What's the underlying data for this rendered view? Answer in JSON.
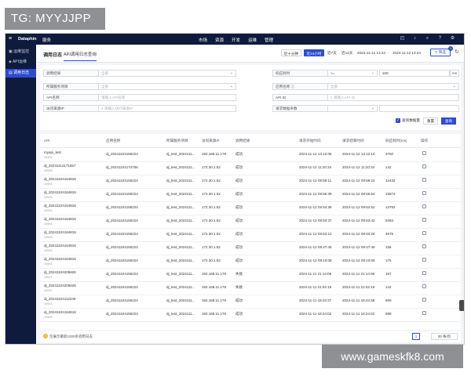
{
  "overlay_label": "TG: MYYJJPP",
  "watermark": "www.gameskfk8.com",
  "topbar": {
    "brand": "Dataphin",
    "service": "服务",
    "nav": [
      "市场",
      "资源",
      "开发",
      "运维",
      "管理"
    ]
  },
  "sidebar": {
    "items": [
      {
        "label": "运维监控"
      },
      {
        "label": "API运维"
      },
      {
        "label": "调用日志"
      }
    ]
  },
  "header": {
    "title": "调用日志",
    "tab": "API调用日志查询",
    "ranges": [
      "近十分钟",
      "近24小时",
      "近7天",
      "近14天"
    ],
    "start_time": "2024-11-12 13:24",
    "end_time": "2024-11-12 13:24",
    "filter_label": "筛选",
    "filter_badge": "1"
  },
  "filters": {
    "row1": {
      "l1": "调用结果",
      "v1": "全部",
      "l2": "响应耗时",
      "v2": ">=",
      "v3": "100",
      "unit": "ms"
    },
    "row2": {
      "l1": "所属服务项目",
      "v1": "全部",
      "l2": "应用名称",
      "v2": "全部"
    },
    "row3": {
      "l1": "API名称",
      "v1": "请输入API名称",
      "l2": "API ID",
      "v2": "请输入API ID"
    },
    "row4": {
      "l1": "访问来源IP",
      "v1": "请输入访问来源IP",
      "l2": "请求数据条数"
    },
    "checkbox_label": "查询数据量",
    "reset": "重置",
    "query": "查询"
  },
  "table": {
    "headers": [
      "API",
      "应用名称",
      "所属服务项目",
      "访问来源IP",
      "调用结果",
      "请求开始时间",
      "请求结束时间",
      "响应耗时(ms)",
      "操作"
    ],
    "rows": [
      {
        "api": "myapi_test",
        "api_id": "10491",
        "app": "dj_20241104165224",
        "project": "dj_test_2024111...",
        "ip": "192.168.11.178",
        "result": "成功",
        "start": "2024-11-12 13:12:06",
        "end": "2024-11-12 13:12:10",
        "ms": "3760"
      },
      {
        "api": "dj_20241112171657",
        "api_id": "10595",
        "app": "dj_20241104174706",
        "project": "dj_test_2024111...",
        "ip": "172.30.1.52",
        "result": "成功",
        "start": "2024-11-12 11:20:34",
        "end": "2024-11-12 11:20:34",
        "ms": "142"
      },
      {
        "api": "dj_20241104164818",
        "api_id": "10594",
        "app": "dj_20241104165224",
        "project": "dj_test_2024111...",
        "ip": "172.30.1.52",
        "result": "成功",
        "start": "2024-11-12 09:59:11",
        "end": "2024-11-12 09:59:23",
        "ms": "12432"
      },
      {
        "api": "dj_20241104164818",
        "api_id": "10594",
        "app": "dj_20241104165224",
        "project": "dj_test_2024111...",
        "ip": "172.30.1.52",
        "result": "成功",
        "start": "2024-11-12 09:55:39",
        "end": "2024-11-12 09:55:54",
        "ms": "15974"
      },
      {
        "api": "dj_20241104164818",
        "api_id": "10594",
        "app": "dj_20241104165224",
        "project": "dj_test_2024111...",
        "ip": "172.30.1.52",
        "result": "成功",
        "start": "2024-11-12 09:54:38",
        "end": "2024-11-12 09:54:52",
        "ms": "13792"
      },
      {
        "api": "dj_20241104164818",
        "api_id": "10594",
        "app": "dj_20241104165224",
        "project": "dj_test_2024111...",
        "ip": "172.30.1.52",
        "result": "成功",
        "start": "2024-11-12 09:53:37",
        "end": "2024-11-12 09:53:42",
        "ms": "5493"
      },
      {
        "api": "dj_20241104164818",
        "api_id": "10594",
        "app": "dj_20241104165224",
        "project": "dj_test_2024111...",
        "ip": "172.30.1.52",
        "result": "成功",
        "start": "2024-11-12 09:53:21",
        "end": "2024-11-12 09:53:25",
        "ms": "4675"
      },
      {
        "api": "dj_20241104164818",
        "api_id": "10594",
        "app": "dj_20241104165224",
        "project": "dj_test_2024111...",
        "ip": "172.30.1.52",
        "result": "成功",
        "start": "2024-11-12 09:47:45",
        "end": "2024-11-12 09:47:46",
        "ms": "156"
      },
      {
        "api": "dj_20241104164818",
        "api_id": "10594",
        "app": "dj_20241104165224",
        "project": "dj_test_2024111...",
        "ip": "172.30.1.52",
        "result": "成功",
        "start": "2024-11-12 09:10:08",
        "end": "2024-11-12 09:10:09",
        "ms": "175"
      },
      {
        "api": "dj_20241104205626",
        "api_id": "10511",
        "app": "dj_20241104165224",
        "project": "dj_test_2024111...",
        "ip": "192.168.11.178",
        "result": "失败",
        "start": "2024-11-11 21:14:06",
        "end": "2024-11-11 21:14:06",
        "ms": "157"
      },
      {
        "api": "dj_20241104205626",
        "api_id": "10511",
        "app": "dj_20241104165224",
        "project": "dj_test_2024111...",
        "ip": "192.168.11.178",
        "result": "失败",
        "start": "2024-11-11 21:02:19",
        "end": "2024-11-11 21:02:19",
        "ms": "142"
      },
      {
        "api": "dj_20241104112249",
        "api_id": "10515",
        "app": "dj_20241104165224",
        "project": "dj_test_2024111...",
        "ip": "192.168.11.178",
        "result": "成功",
        "start": "2024-11-11 18:43:37",
        "end": "2024-11-11 18:43:38",
        "ms": "609"
      },
      {
        "api": "dj_20241104164818",
        "api_id": "10506",
        "app": "dj_20241104165224",
        "project": "dj_test_2024111...",
        "ip": "192.168.11.178",
        "result": "成功",
        "start": "2024-11-11 18:24:02",
        "end": "2024-11-11 18:24:02",
        "ms": "599"
      }
    ]
  },
  "footer": {
    "note": "仅展示最新1000条调用日志",
    "page": "1",
    "page_size": "20 条/页"
  }
}
